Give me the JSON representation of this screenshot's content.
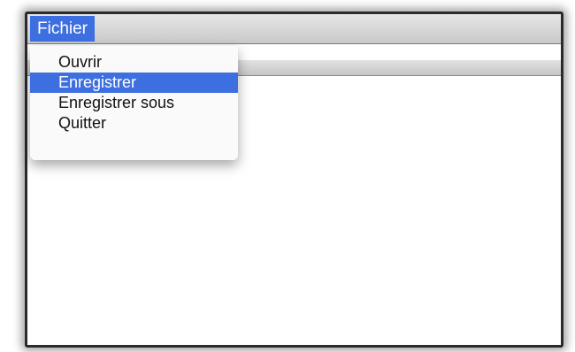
{
  "menubar": {
    "title": "Fichier"
  },
  "menu": {
    "items": [
      {
        "label": "Ouvrir",
        "selected": false
      },
      {
        "label": "Enregistrer",
        "selected": true
      },
      {
        "label": "Enregistrer sous",
        "selected": false
      },
      {
        "label": "Quitter",
        "selected": false
      }
    ]
  },
  "colors": {
    "highlight": "#3e6fe0",
    "highlight_text": "#ffffff",
    "menu_text": "#111111"
  }
}
